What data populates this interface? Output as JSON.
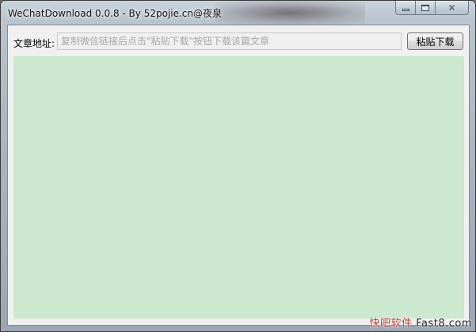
{
  "window": {
    "title": "WeChatDownload 0.0.8 - By 52pojie.cn@夜泉",
    "controls": {
      "minimize_icon": "minimize-icon",
      "maximize_icon": "maximize-icon",
      "close_icon": "close-icon",
      "close_glyph": "✕"
    }
  },
  "toolbar": {
    "url_label": "文章地址:",
    "url_value": "",
    "url_placeholder": "复制微信链接后点击\"粘贴下载\"按钮下载该篇文章",
    "paste_button_label": "粘贴下载"
  },
  "content": {
    "background_color": "#cce8cf"
  },
  "watermark": {
    "cn": "快吧软件",
    "en": "Fast8.com"
  }
}
